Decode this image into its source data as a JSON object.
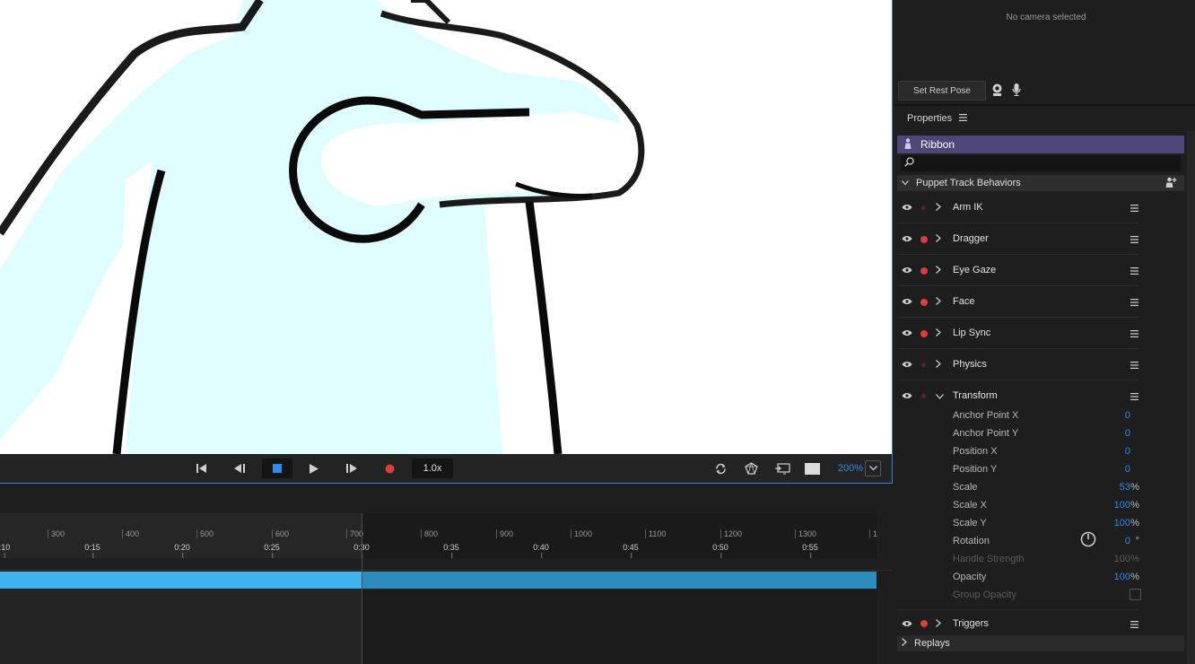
{
  "camera": {
    "status_text": "No camera selected",
    "rest_pose_label": "Set Rest Pose",
    "webcam_icon": "webcam-icon",
    "mic_icon": "microphone-icon"
  },
  "transport": {
    "speed": "1.0x",
    "zoom": "200%",
    "buttons": [
      "go-to-start-icon",
      "step-back-icon",
      "stop-icon",
      "play-icon",
      "step-forward-icon",
      "record-icon",
      "loop-icon",
      "camera-view-icon",
      "output-icon",
      "background-color-icon",
      "zoom-chevron-icon"
    ]
  },
  "timeline": {
    "frame_ticks": [
      "300",
      "400",
      "500",
      "600",
      "700",
      "800",
      "900",
      "1000",
      "1100",
      "1200",
      "1300",
      "1"
    ],
    "time_ticks": [
      ":10",
      "0:15",
      "0:20",
      "0:25",
      "0:30",
      "0:35",
      "0:40",
      "0:45",
      "0:50",
      "0:55"
    ]
  },
  "properties": {
    "title": "Properties",
    "puppet_name": "Ribbon",
    "section_title": "Puppet Track Behaviors",
    "behaviors": [
      {
        "name": "Arm IK",
        "armed": false
      },
      {
        "name": "Dragger",
        "armed": true
      },
      {
        "name": "Eye Gaze",
        "armed": true
      },
      {
        "name": "Face",
        "armed": true
      },
      {
        "name": "Lip Sync",
        "armed": true
      },
      {
        "name": "Physics",
        "armed": false
      },
      {
        "name": "Transform",
        "armed": false,
        "expanded": true
      },
      {
        "name": "Triggers",
        "armed": true
      }
    ],
    "transform_params": [
      {
        "name": "Anchor Point X",
        "value": "0",
        "unit": ""
      },
      {
        "name": "Anchor Point Y",
        "value": "0",
        "unit": ""
      },
      {
        "name": "Position X",
        "value": "0",
        "unit": ""
      },
      {
        "name": "Position Y",
        "value": "0",
        "unit": ""
      },
      {
        "name": "Scale",
        "value": "53",
        "unit": "%"
      },
      {
        "name": "Scale X",
        "value": "100",
        "unit": "%"
      },
      {
        "name": "Scale Y",
        "value": "100",
        "unit": "%"
      },
      {
        "name": "Rotation",
        "value": "0",
        "unit": "°"
      },
      {
        "name": "Handle Strength",
        "value": "100",
        "unit": "%"
      },
      {
        "name": "Opacity",
        "value": "100",
        "unit": "%"
      },
      {
        "name": "Group Opacity",
        "value": "",
        "unit": ""
      }
    ],
    "replays_label": "Replays"
  },
  "colors": {
    "accent_blue": "#2d8ceb",
    "puppet_row": "#4e4578",
    "record_red": "#e03b3b",
    "track_bar": "#3fb4ee"
  }
}
